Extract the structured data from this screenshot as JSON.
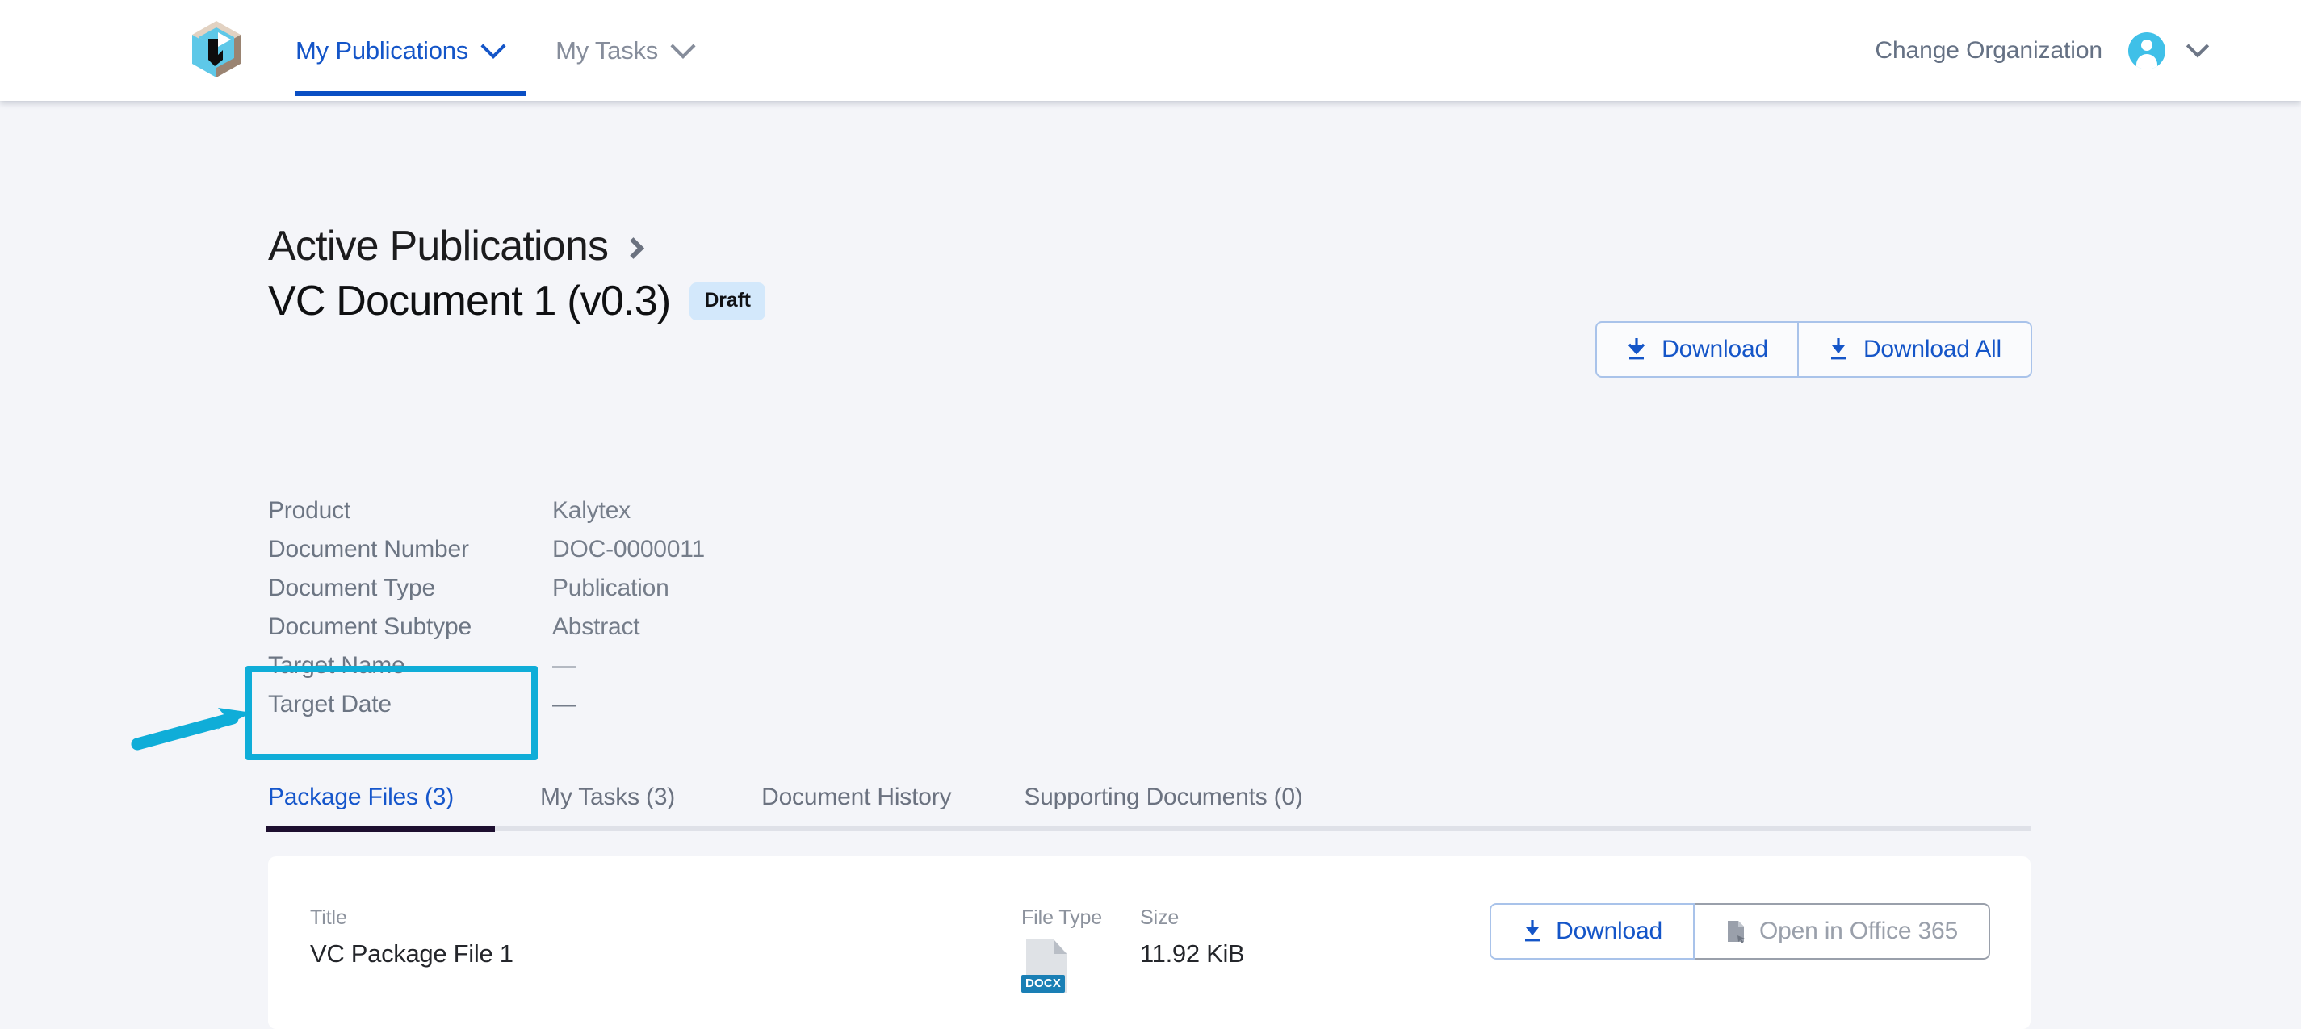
{
  "header": {
    "logo_name": "company-cube-logo",
    "nav": [
      {
        "label": "My Publications",
        "active": true
      },
      {
        "label": "My Tasks",
        "active": false
      }
    ],
    "change_organization": "Change Organization"
  },
  "breadcrumb": {
    "parent": "Active Publications",
    "separator": "chevron-right"
  },
  "title": {
    "document": "VC Document 1 (v0.3)",
    "status_badge": "Draft"
  },
  "toolbar": {
    "download_label": "Download",
    "download_all_label": "Download All"
  },
  "meta": {
    "rows": [
      {
        "label": "Product",
        "value": "Kalytex"
      },
      {
        "label": "Document Number",
        "value": "DOC-0000011"
      },
      {
        "label": "Document Type",
        "value": "Publication"
      },
      {
        "label": "Document Subtype",
        "value": "Abstract"
      },
      {
        "label": "Target Name",
        "value": "—"
      },
      {
        "label": "Target Date",
        "value": "—"
      }
    ]
  },
  "tabs": [
    {
      "label": "Package Files (3)",
      "active": true
    },
    {
      "label": "My Tasks (3)",
      "active": false
    },
    {
      "label": "Document History",
      "active": false
    },
    {
      "label": "Supporting Documents (0)",
      "active": false
    }
  ],
  "file_table": {
    "headers": {
      "title": "Title",
      "file_type": "File Type",
      "size": "Size"
    },
    "rows": [
      {
        "title": "VC Package File 1",
        "file_type": "DOCX",
        "size": "11.92 KiB",
        "download_label": "Download",
        "open_label": "Open in Office 365"
      }
    ]
  },
  "colors": {
    "page_background": "#f4f5f9",
    "link_blue": "#1455c8",
    "nav_underline": "#0a4fc4",
    "badge_background": "#d3e8fb",
    "active_tab_underline": "#1d0f30",
    "annotation_cyan": "#0fadd8",
    "avatar_blue": "#3fc0e8",
    "docx_tag_blue": "#1a7fb5"
  }
}
